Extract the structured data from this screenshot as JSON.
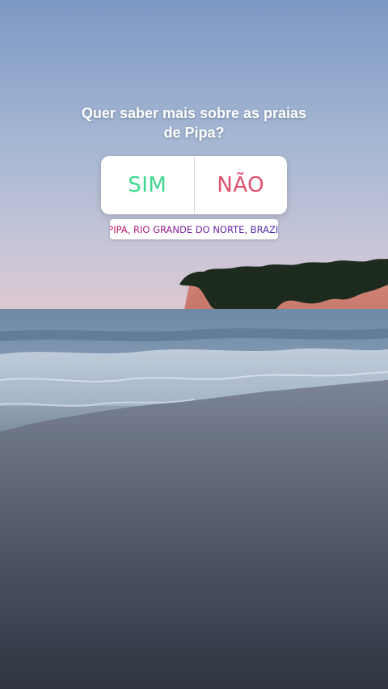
{
  "story": {
    "question": "Quer saber mais sobre as praias de Pipa?",
    "poll": {
      "yes_label": "SIM",
      "no_label": "NÃO",
      "yes_color": "#3ed98e",
      "no_color": "#e0506d"
    },
    "location": {
      "icon": "location-pin-icon",
      "label": "PIPA, RIO GRANDE DO NORTE, BRAZIL",
      "accent_start": "#c2185b",
      "accent_end": "#4a2bb0"
    }
  }
}
